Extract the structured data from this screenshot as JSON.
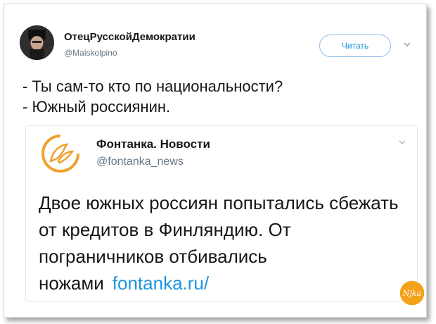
{
  "tweet": {
    "author_name": "ОтецРусскойДемократии",
    "author_handle": "@Maiskolpino",
    "follow_label": "Читать",
    "lines": [
      "- Ты сам-то кто по национальности?",
      "- Южный россиянин."
    ]
  },
  "quoted": {
    "author_name": "Фонтанка. Новости",
    "author_handle": "@fontanka_news",
    "text": "Двое южных россиян попытались сбежать от кредитов в Финляндию. От пограничников отбивались ножами",
    "link": "fontanka.ru/"
  },
  "watermark": {
    "text": "Njka"
  },
  "colors": {
    "accent": "#1b95e0",
    "logo": "#f0a030",
    "badge": "#f5a11c"
  },
  "icons": [
    "avatar",
    "chevron-down-icon",
    "fontanka-logo-icon",
    "watermark-badge-icon"
  ]
}
